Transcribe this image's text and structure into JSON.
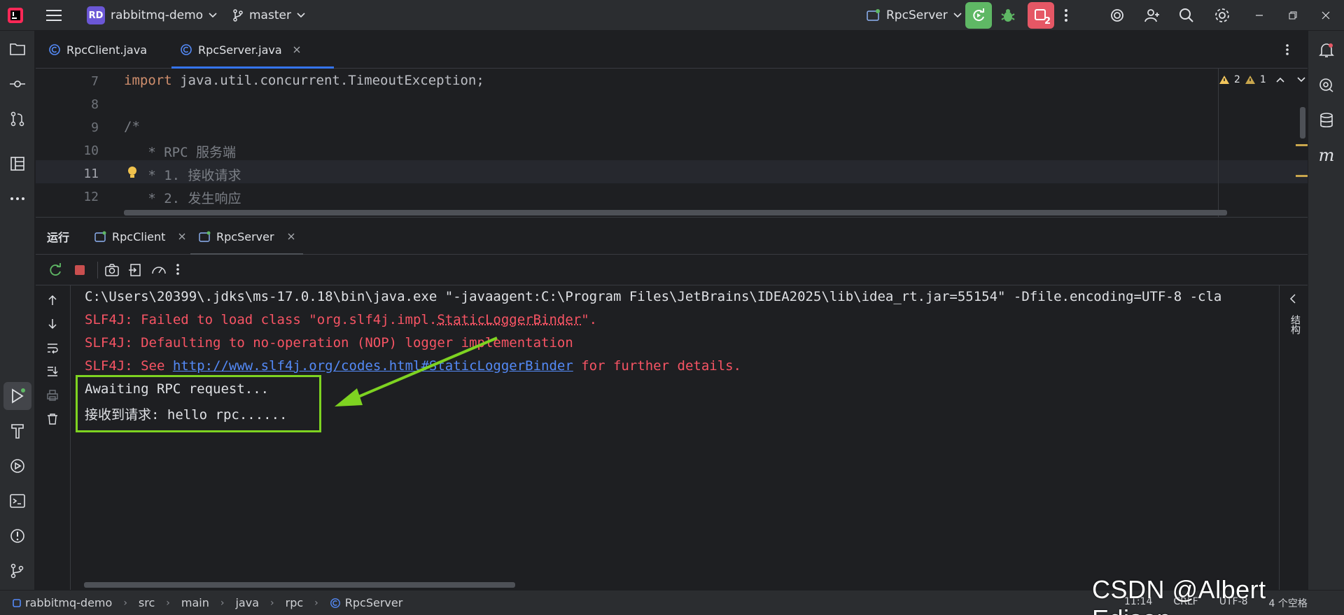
{
  "titlebar": {
    "project_badge": "RD",
    "project_name": "rabbitmq-demo",
    "branch": "master",
    "run_config": "RpcServer",
    "stop_count": "2"
  },
  "editor_tabs": [
    {
      "label": "RpcClient.java"
    },
    {
      "label": "RpcServer.java"
    }
  ],
  "editor": {
    "lines": [
      {
        "num": "7",
        "keyword": "import",
        "text": " java.util.concurrent.TimeoutException;"
      },
      {
        "num": "8",
        "keyword": "",
        "text": ""
      },
      {
        "num": "9",
        "keyword": "",
        "text": "/*"
      },
      {
        "num": "10",
        "keyword": "",
        "text": "   * RPC 服务端"
      },
      {
        "num": "11",
        "keyword": "",
        "text": "   * 1. 接收请求"
      },
      {
        "num": "12",
        "keyword": "",
        "text": "   * 2. 发生响应"
      }
    ],
    "warnings": "2",
    "weak_warnings": "1"
  },
  "run": {
    "title": "运行",
    "tabs": [
      {
        "label": "RpcClient"
      },
      {
        "label": "RpcServer"
      }
    ]
  },
  "console": {
    "cmd": "C:\\Users\\20399\\.jdks\\ms-17.0.18\\bin\\java.exe \"-javaagent:C:\\Program Files\\JetBrains\\IDEA2025\\lib\\idea_rt.jar=55154\" -Dfile.encoding=UTF-8 -cla",
    "err1_prefix": "SLF4J: Failed to load class \"org.slf4j.impl.",
    "err1_class": "StaticLoggerBinder",
    "err1_suffix": "\".",
    "err2": "SLF4J: Defaulting to no-operation (NOP) logger implementation",
    "err3_prefix": "SLF4J: See ",
    "err3_link": "http://www.slf4j.org/codes.html#StaticLoggerBinder",
    "err3_suffix": " for further details.",
    "out1": "Awaiting RPC request...",
    "out2": "接收到请求: hello rpc......"
  },
  "right_panel_label": "结构",
  "statusbar": {
    "crumbs": [
      "rabbitmq-demo",
      "src",
      "main",
      "java",
      "rpc",
      "RpcServer"
    ],
    "position": "11:14",
    "line_sep": "CRLF",
    "encoding": "UTF-8",
    "indent": "4 个空格"
  },
  "watermark": "CSDN @Albert Edison",
  "colors": {
    "accent": "#3574f0",
    "error": "#f75464",
    "highlight": "#7ed321",
    "run_green": "#5fb865",
    "stop_red": "#e55765"
  }
}
